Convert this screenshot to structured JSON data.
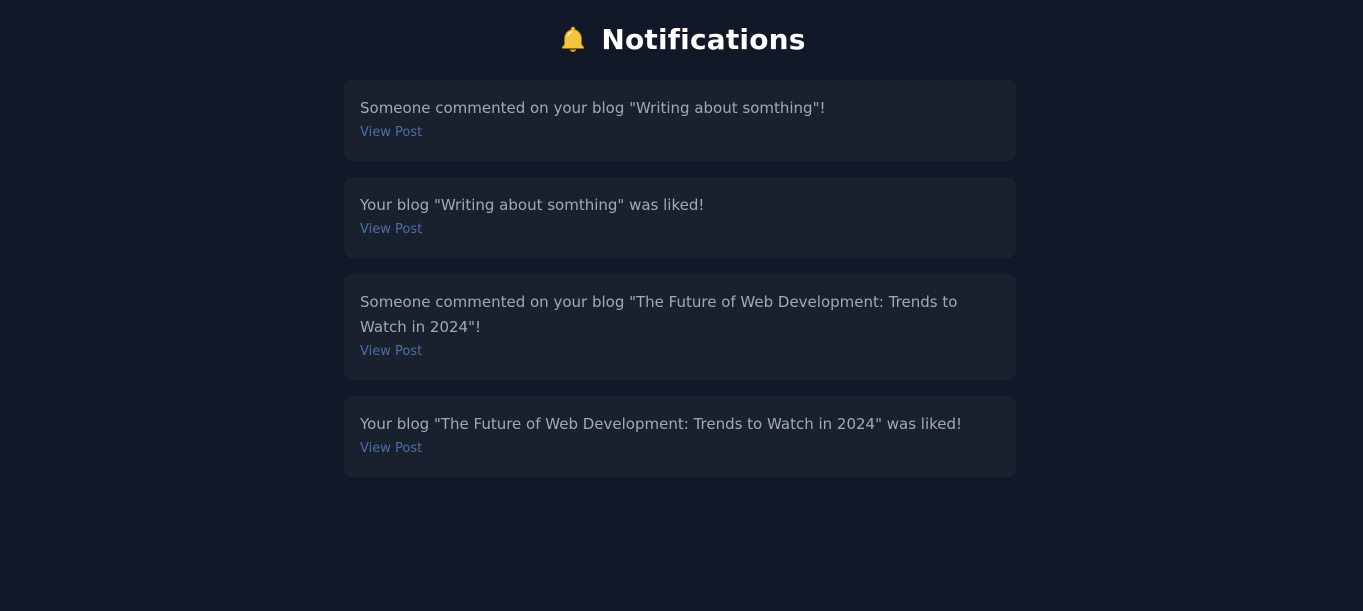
{
  "header": {
    "icon": "bell-icon",
    "title": "Notifications"
  },
  "colors": {
    "background": "#111827",
    "card": "#19212f",
    "text": "#a3a9b3",
    "link": "#4d6ea5",
    "bell": "#f6c33c"
  },
  "notifications": [
    {
      "message": "Someone commented on your blog \"Writing about somthing\"!",
      "link_label": "View Post"
    },
    {
      "message": "Your blog \"Writing about somthing\" was liked!",
      "link_label": "View Post"
    },
    {
      "message": "Someone commented on your blog \"The Future of Web Development: Trends to Watch in 2024\"!",
      "link_label": "View Post"
    },
    {
      "message": "Your blog \"The Future of Web Development: Trends to Watch in 2024\" was liked!",
      "link_label": "View Post"
    }
  ]
}
